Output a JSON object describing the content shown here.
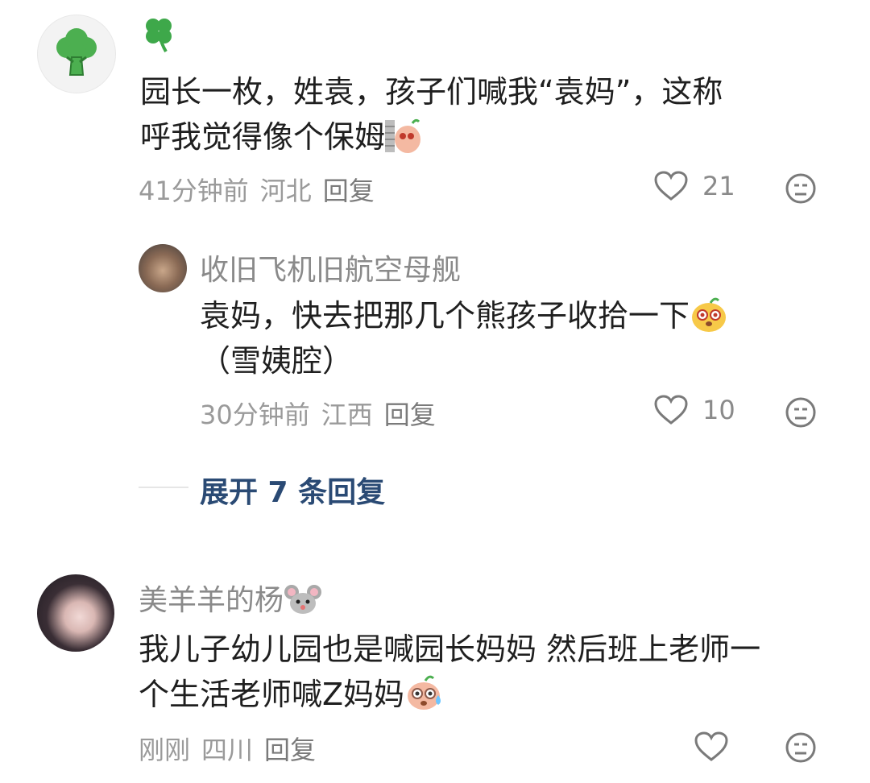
{
  "comments": [
    {
      "username_icon": "four-leaf-clover-icon",
      "text_line1": "园长一枚，姓袁，孩子们喊我“袁妈”，这称",
      "text_line2": "呼我觉得像个保姆",
      "time": "41分钟前",
      "location": "河北",
      "reply_label": "回复",
      "likes": "21",
      "avatar_icon": "broccoli-icon",
      "reply": {
        "username": "收旧飞机旧航空母舰",
        "text_line1": "袁妈，快去把那几个熊孩子收拾一下",
        "text_line2": "（雪姨腔）",
        "time": "30分钟前",
        "location": "江西",
        "reply_label": "回复",
        "likes": "10"
      },
      "expand_label": "展开 7 条回复"
    },
    {
      "username": "美羊羊的杨",
      "username_icon": "mouse-face-icon",
      "text_line1": "我儿子幼儿园也是喊园长妈妈 然后班上老师一",
      "text_line2": "个生活老师喊Z妈妈",
      "time": "刚刚",
      "location": "四川",
      "reply_label": "回复",
      "likes": ""
    }
  ],
  "colors": {
    "accent_link": "#2a4a74",
    "muted": "#9a9a9a",
    "broccoli": "#4caf50"
  }
}
